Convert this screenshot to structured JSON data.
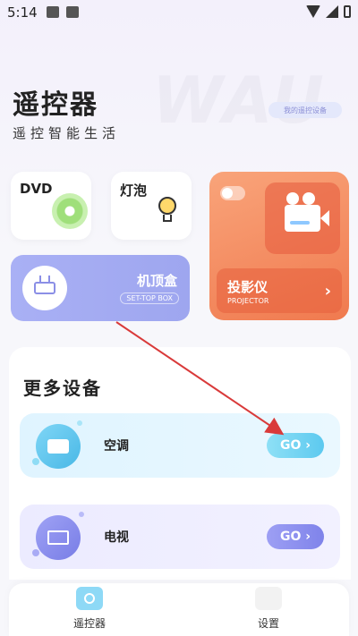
{
  "status_bar": {
    "time": "5:14"
  },
  "header": {
    "watermark": "WAU",
    "title": "遥控器",
    "subtitle": "遥控智能生活",
    "my_devices": "我的遥控设备"
  },
  "devices_top": {
    "dvd": {
      "label": "DVD"
    },
    "bulb": {
      "label": "灯泡"
    },
    "stb": {
      "label": "机顶盒",
      "sub": "SET-TOP BOX"
    },
    "projector": {
      "label": "投影仪",
      "sub": "PROJECTOR",
      "chevron": "›"
    }
  },
  "more_devices": {
    "title": "更多设备",
    "items": [
      {
        "name": "空调",
        "go": "GO ›"
      },
      {
        "name": "电视",
        "go": "GO ›"
      }
    ]
  },
  "tabbar": {
    "tabs": [
      {
        "label": "遥控器"
      },
      {
        "label": "设置"
      }
    ]
  },
  "colors": {
    "accent_blue": "#5cc9ef",
    "accent_purple": "#7f83ea",
    "projector_orange": "#f07a4f",
    "annotation_red": "#d93a3a"
  }
}
